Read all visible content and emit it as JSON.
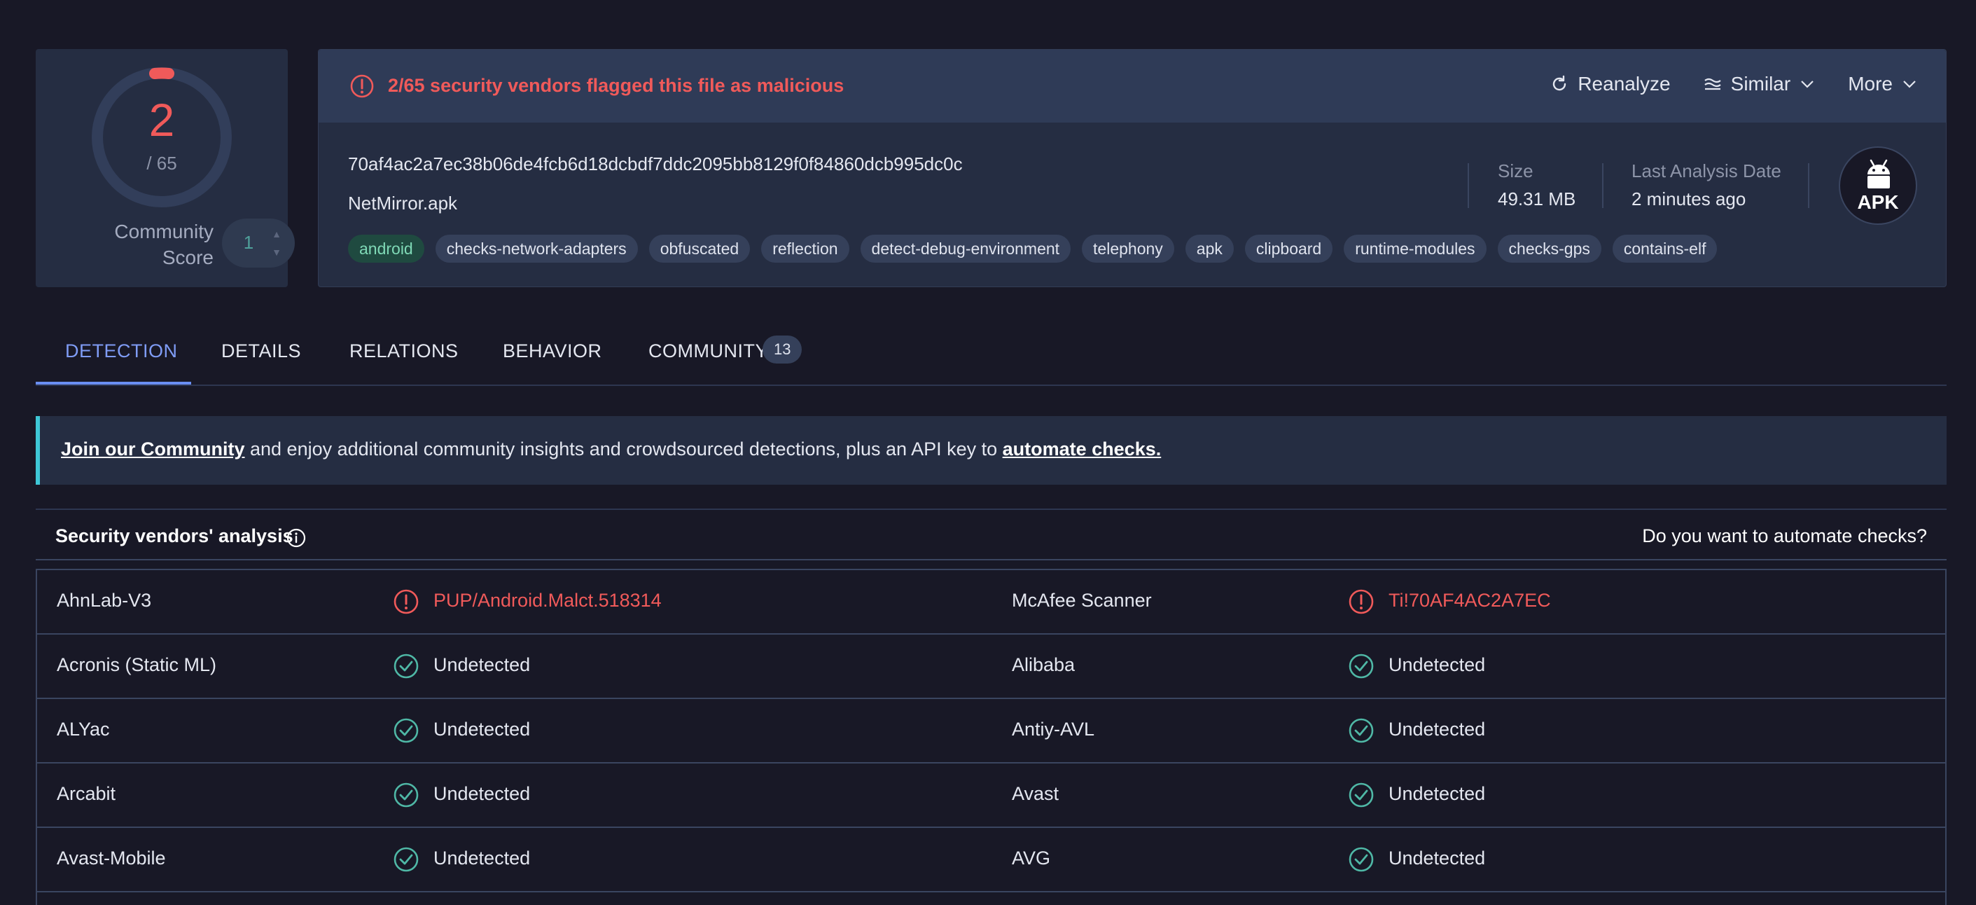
{
  "score": {
    "detections": "2",
    "total": "/ 65",
    "community_label": "Community Score",
    "community_value": "1"
  },
  "alert": {
    "text": "2/65 security vendors flagged this file as malicious",
    "color": "#f05a5a"
  },
  "actions": {
    "reanalyze": "Reanalyze",
    "similar": "Similar",
    "more": "More"
  },
  "file": {
    "hash": "70af4ac2a7ec38b06de4fcb6d18dcbdf7ddc2095bb8129f0f84860dcb995dc0c",
    "name": "NetMirror.apk",
    "size_label": "Size",
    "size_value": "49.31 MB",
    "date_label": "Last Analysis Date",
    "date_value": "2 minutes ago",
    "type_icon": "APK",
    "tags": [
      "android",
      "checks-network-adapters",
      "obfuscated",
      "reflection",
      "detect-debug-environment",
      "telephony",
      "apk",
      "clipboard",
      "runtime-modules",
      "checks-gps",
      "contains-elf"
    ]
  },
  "tabs": {
    "detection": "DETECTION",
    "details": "DETAILS",
    "relations": "RELATIONS",
    "behavior": "BEHAVIOR",
    "community": "COMMUNITY",
    "community_count": "13"
  },
  "banner": {
    "join_link": "Join our Community",
    "middle": " and enjoy additional community insights and crowdsourced detections, plus an API key to ",
    "automate_link": "automate checks."
  },
  "vendors_header": {
    "title": "Security vendors' analysis",
    "right": "Do you want to automate checks?"
  },
  "vendors": [
    {
      "left_name": "AhnLab-V3",
      "left_result": "PUP/Android.Malct.518314",
      "left_status": "malicious",
      "right_name": "McAfee Scanner",
      "right_result": "Ti!70AF4AC2A7EC",
      "right_status": "malicious"
    },
    {
      "left_name": "Acronis (Static ML)",
      "left_result": "Undetected",
      "left_status": "clean",
      "right_name": "Alibaba",
      "right_result": "Undetected",
      "right_status": "clean"
    },
    {
      "left_name": "ALYac",
      "left_result": "Undetected",
      "left_status": "clean",
      "right_name": "Antiy-AVL",
      "right_result": "Undetected",
      "right_status": "clean"
    },
    {
      "left_name": "Arcabit",
      "left_result": "Undetected",
      "left_status": "clean",
      "right_name": "Avast",
      "right_result": "Undetected",
      "right_status": "clean"
    },
    {
      "left_name": "Avast-Mobile",
      "left_result": "Undetected",
      "left_status": "clean",
      "right_name": "AVG",
      "right_result": "Undetected",
      "right_status": "clean"
    }
  ]
}
